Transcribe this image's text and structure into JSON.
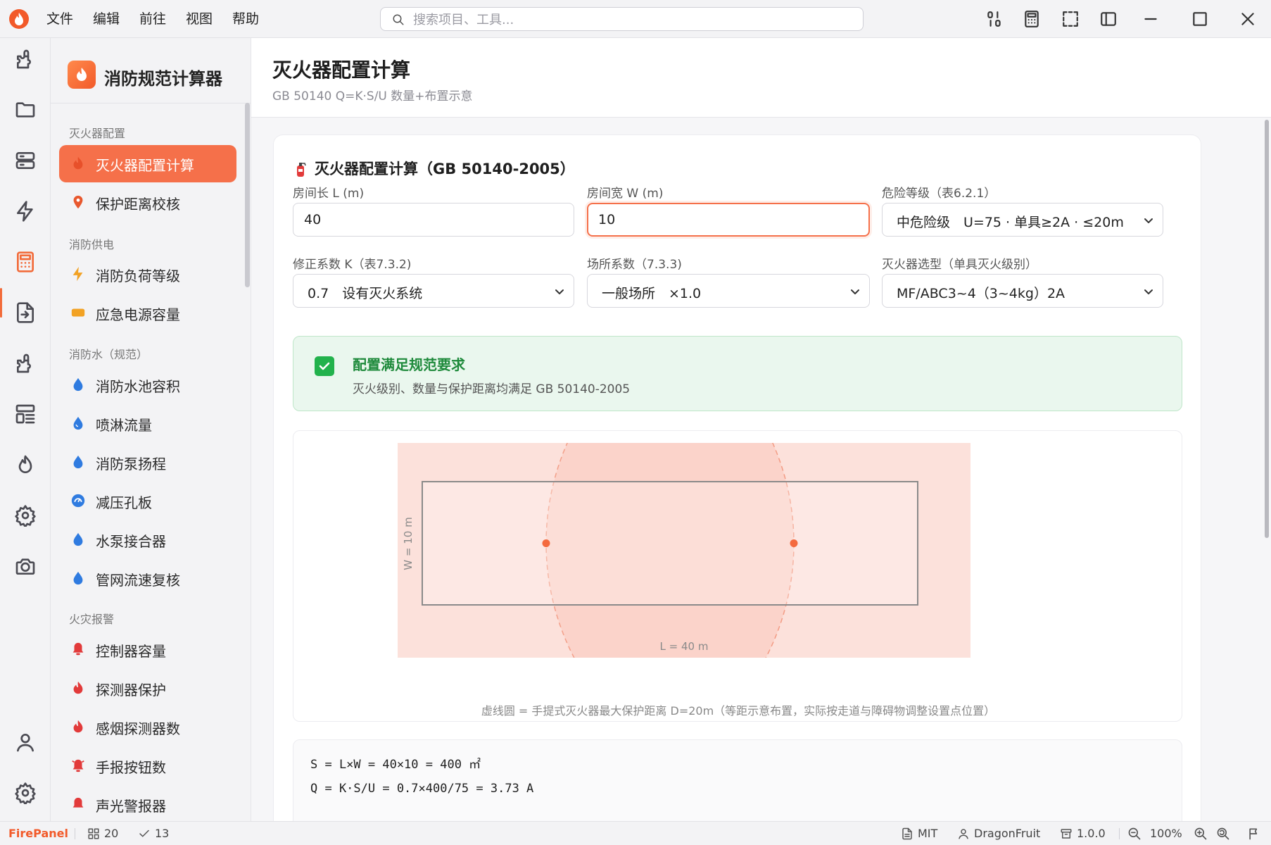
{
  "menu": [
    "文件",
    "编辑",
    "前往",
    "视图",
    "帮助"
  ],
  "search": {
    "placeholder": "搜索项目、工具..."
  },
  "brand": {
    "name": "消防规范计算器"
  },
  "sidebar": {
    "groups": [
      {
        "label": "灭火器配置",
        "items": [
          {
            "label": "灭火器配置计算",
            "icon": "flame-icon",
            "active": true
          },
          {
            "label": "保护距离校核",
            "icon": "map-pin-icon"
          }
        ]
      },
      {
        "label": "消防供电",
        "items": [
          {
            "label": "消防负荷等级",
            "icon": "bolt-icon"
          },
          {
            "label": "应急电源容量",
            "icon": "battery-icon"
          }
        ]
      },
      {
        "label": "消防水（规范）",
        "items": [
          {
            "label": "消防水池容积",
            "icon": "droplet-icon"
          },
          {
            "label": "喷淋流量",
            "icon": "droplet-icon"
          },
          {
            "label": "消防泵扬程",
            "icon": "droplet-icon"
          },
          {
            "label": "减压孔板",
            "icon": "gauge-icon"
          },
          {
            "label": "水泵接合器",
            "icon": "droplet-icon"
          },
          {
            "label": "管网流速复核",
            "icon": "droplet-icon"
          }
        ]
      },
      {
        "label": "火灾报警",
        "items": [
          {
            "label": "控制器容量",
            "icon": "bell-icon"
          },
          {
            "label": "探测器保护",
            "icon": "flame-icon"
          },
          {
            "label": "感烟探测器数",
            "icon": "flame-icon"
          },
          {
            "label": "手报按钮数",
            "icon": "alarm-icon"
          },
          {
            "label": "声光警报器",
            "icon": "bell-icon"
          }
        ]
      }
    ]
  },
  "page": {
    "title": "灭火器配置计算",
    "subtitle": "GB 50140 Q=K·S/U 数量+布置示意"
  },
  "card": {
    "title": "灭火器配置计算（GB 50140-2005）",
    "fields": {
      "length": {
        "label": "房间长 L (m)",
        "value": "40"
      },
      "width": {
        "label": "房间宽 W (m)",
        "value": "10"
      },
      "hazard": {
        "label": "危险等级（表6.2.1）",
        "value": "中危险级　U=75 · 单具≥2A · ≤20m"
      },
      "k": {
        "label": "修正系数 K（表7.3.2)",
        "value": "0.7　设有灭火系统"
      },
      "place": {
        "label": "场所系数（7.3.3)",
        "value": "一般场所　×1.0"
      },
      "type": {
        "label": "灭火器选型（单具灭火级别）",
        "value": "MF/ABC3~4（3~4kg）2A"
      }
    },
    "result": {
      "title": "配置满足规范要求",
      "desc": "灭火级别、数量与保护距离均满足 GB 50140-2005"
    },
    "diagram": {
      "room_length_label": "L = 40 m",
      "room_width_label": "W = 10 m",
      "caption": "虚线圆 = 手提式灭火器最大保护距离 D=20m（等距示意布置，实际按走道与障碍物调整设置点位置）",
      "room_length_m": 40,
      "room_width_m": 10,
      "protect_radius_m": 20,
      "extinguisher_x_m": [
        10,
        30
      ]
    },
    "calc": [
      "S = L×W = 40×10 = 400 ㎡",
      "Q = K·S/U = 0.7×400/75 = 3.73 A"
    ]
  },
  "status": {
    "brand": "FirePanel",
    "count": "20",
    "checks": "13",
    "license": "MIT",
    "author": "DragonFruit",
    "version": "1.0.0",
    "zoom": "100%"
  },
  "colors": {
    "accent": "#f5704a",
    "success": "#22b24c",
    "room_fill": "#fdf1ee"
  }
}
